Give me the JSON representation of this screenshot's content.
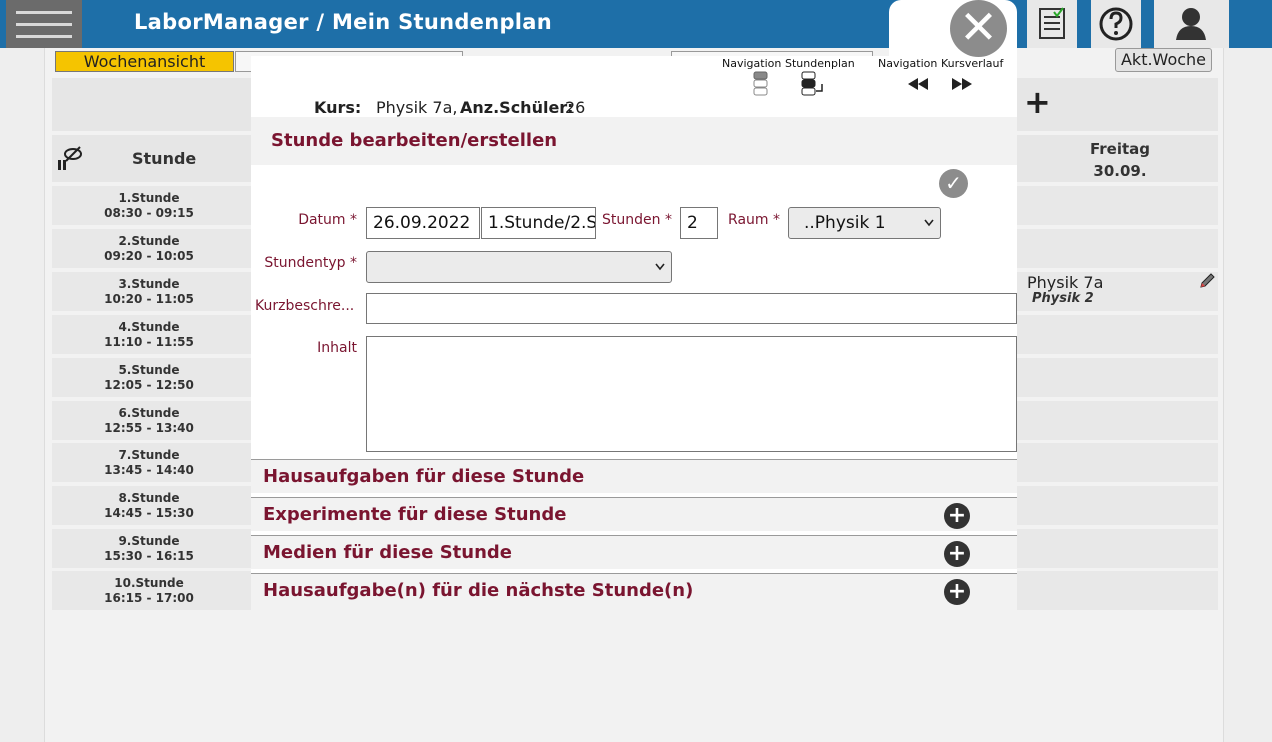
{
  "header": {
    "app_title": "LaborManager /  Mein Stundenplan",
    "icons": [
      "menu-icon",
      "checklist-icon",
      "help-icon",
      "user-icon"
    ]
  },
  "toolbar": {
    "week_view_tab": "Wochenansicht",
    "current_week_button": "Akt.Woche"
  },
  "timetable": {
    "col_period": "Stunde",
    "col_friday_day": "Freitag",
    "col_friday_date": "30.09.",
    "periods": [
      {
        "name": "1.Stunde",
        "time": "08:30  -  09:15"
      },
      {
        "name": "2.Stunde",
        "time": "09:20  -  10:05"
      },
      {
        "name": "3.Stunde",
        "time": "10:20  -  11:05"
      },
      {
        "name": "4.Stunde",
        "time": "11:10  -  11:55"
      },
      {
        "name": "5.Stunde",
        "time": "12:05  -  12:50"
      },
      {
        "name": "6.Stunde",
        "time": "12:55  -  13:40"
      },
      {
        "name": "7.Stunde",
        "time": "13:45  -  14:40"
      },
      {
        "name": "8.Stunde",
        "time": "14:45  -  15:30"
      },
      {
        "name": "9.Stunde",
        "time": "15:30  -  16:15"
      },
      {
        "name": "10.Stunde",
        "time": "16:15  -  17:00"
      }
    ],
    "friday_entry": {
      "course": "Physik  7a",
      "room": "Physik  2"
    }
  },
  "modal": {
    "nav_labels": {
      "navigation_left": "Navigation",
      "stundenplan": "Stundenplan",
      "navigation_right": "Navigation",
      "kursverlauf": "Kursverlauf"
    },
    "kurs_label": "Kurs:",
    "kurs_value": "Physik  7a,",
    "anz_label": "Anz.Schüler:",
    "anz_value": "26",
    "section_title": "Stunde  bearbeiten/erstellen",
    "form": {
      "datum_label": "Datum",
      "datum_value": "26.09.2022",
      "stunde_value": "1.Stunde/2.S",
      "stunden_label": "Stunden",
      "stunden_value": "2",
      "raum_label": "Raum",
      "raum_value": "..Physik 1",
      "stundentyp_label": "Stundentyp",
      "stundentyp_value": "",
      "kurzbeschreibung_label": "Kurzbeschre...",
      "kurzbeschreibung_value": "",
      "inhalt_label": "Inhalt",
      "inhalt_value": "",
      "required_mark": "*"
    },
    "accordions": [
      {
        "title": "Hausaufgaben  für  diese  Stunde",
        "has_add": false
      },
      {
        "title": "Experimente  für  diese  Stunde",
        "has_add": true
      },
      {
        "title": "Medien  für  diese  Stunde",
        "has_add": true
      },
      {
        "title": "Hausaufgabe(n)  für  die  nächste  Stunde(n)",
        "has_add": true
      }
    ]
  },
  "colors": {
    "topbar": "#1e6fa8",
    "accent_maroon": "#7a1530",
    "week_tab": "#f5c400"
  }
}
